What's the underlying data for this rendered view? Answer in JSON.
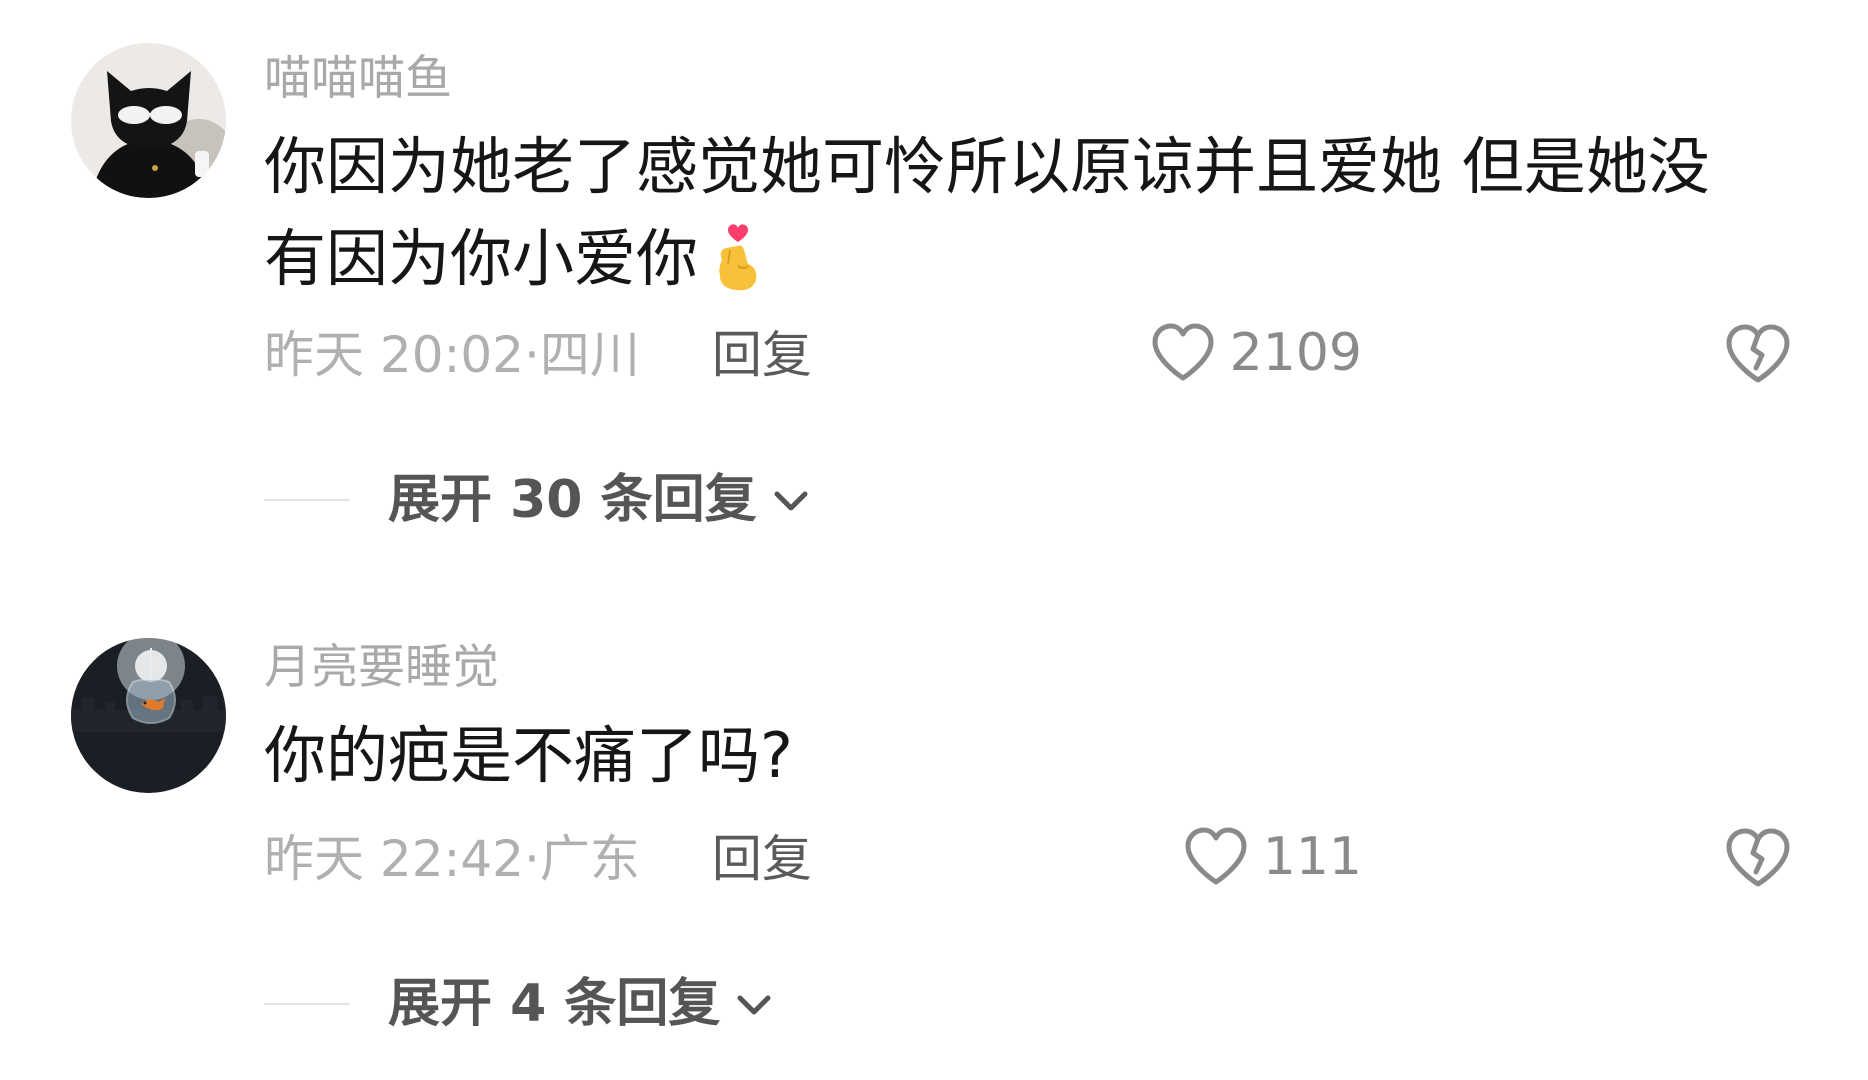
{
  "comments": [
    {
      "username": "喵喵喵鱼",
      "text_line1": "你因为她老了感觉她可怜所以原谅并且爱她 但是她没",
      "text_line2": "有因为你小爱你",
      "emoji": "hand-with-index-finger-and-thumb-crossed-heart",
      "time": "昨天 20:02",
      "separator": "·",
      "location": "四川",
      "reply_label": "回复",
      "likes": "2109",
      "expand_label": "展开 30 条回复",
      "avatar": "black-cat-with-sunglasses"
    },
    {
      "username": "月亮要睡觉",
      "text_line1": "你的疤是不痛了吗?",
      "time": "昨天 22:42",
      "separator": "·",
      "location": "广东",
      "reply_label": "回复",
      "likes": "111",
      "expand_label": "展开 4 条回复",
      "avatar": "goldfish-in-glass-bowl"
    }
  ],
  "icons": {
    "like": "heart-outline-icon",
    "dislike": "broken-heart-icon",
    "expand": "chevron-down-icon"
  },
  "colors": {
    "username": "#a9a9a9",
    "text": "#161616",
    "meta": "#b0b0b0",
    "reply": "#5a5a5a",
    "like_count": "#8a8a8a",
    "expand": "#555555"
  }
}
